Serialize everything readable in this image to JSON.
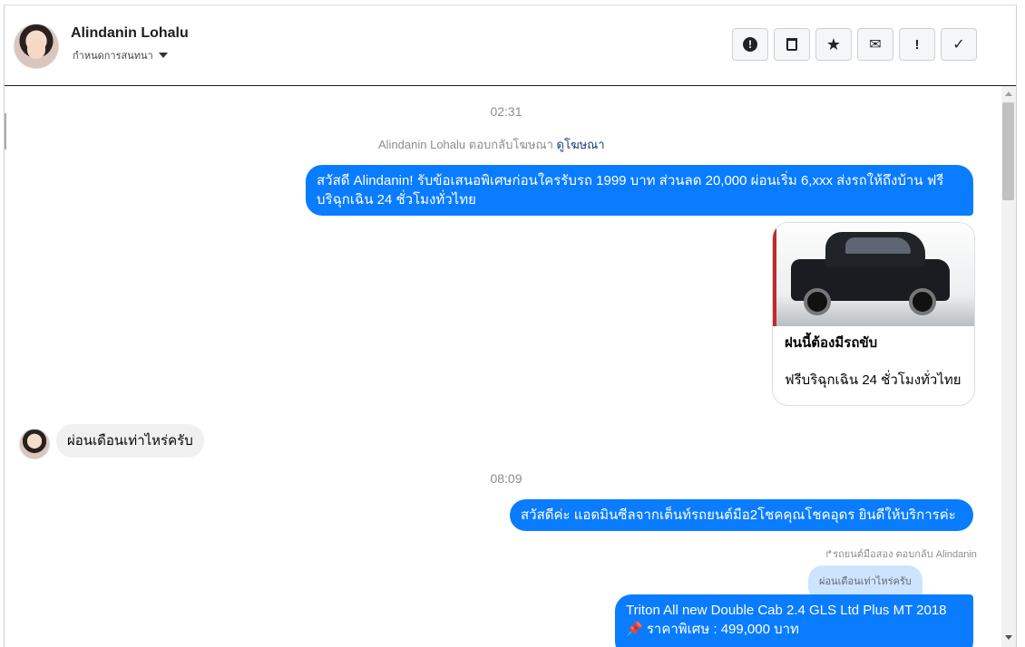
{
  "header": {
    "contact_name": "Alindanin Lohalu",
    "conversation_label": "กำหนดการสนทนา",
    "actions": [
      {
        "name": "spam-button",
        "icon": "alert-circle-icon",
        "glyph": "❗"
      },
      {
        "name": "delete-button",
        "icon": "trash-icon",
        "glyph": "🗑"
      },
      {
        "name": "star-button",
        "icon": "star-icon",
        "glyph": "★"
      },
      {
        "name": "mark-unread-button",
        "icon": "envelope-icon",
        "glyph": "✉"
      },
      {
        "name": "important-button",
        "icon": "exclamation-icon",
        "glyph": "!"
      },
      {
        "name": "done-button",
        "icon": "check-icon",
        "glyph": "✓"
      }
    ]
  },
  "messages": {
    "timestamp_1": "02:31",
    "ad_reply_prefix": "Alindanin Lohalu ตอบกลับโฆษณา",
    "ad_reply_link": "ดูโฆษณา",
    "out_1": "สวัสดี Alindanin! รับข้อเสนอพิเศษก่อนใครรับรถ 1999 บาท ส่วนลด 20,000  ผ่อนเริ่ม 6,xxx ส่งรถให้ถึงบ้าน ฟรี บริฉุกเฉิน 24 ชั่วโมงทั่วไทย",
    "card_title": "ฝนนี้ต้องมีรถขับ",
    "card_subtitle": "ฟรีบริฉุกเฉิน 24 ชั่วโมงทั่วไทย",
    "in_1": "ผ่อนเดือนเท่าไหร่ครับ",
    "timestamp_2": "08:09",
    "out_2": "สวัสดีค่ะ แอดมินซีลจากเต็นท์รถยนต์มือ2โชคคุณโชคอุดร ยินดีให้บริการค่ะ",
    "reply_to_label": "รถยนต์มือสอง ตอบกลับ Alindanin",
    "reply_quote": "ผ่อนเดือนเท่าไหร่ครับ",
    "out_3_line1": "Triton All new Double Cab 2.4 GLS Ltd Plus MT 2018",
    "out_3_line2": "📌 ราคาพิเศษ : 499,000 บาท"
  },
  "colors": {
    "outgoing_bubble": "#0a7cff",
    "incoming_bubble": "#f0f0f0",
    "reply_quote_bg": "#cce4ff"
  }
}
